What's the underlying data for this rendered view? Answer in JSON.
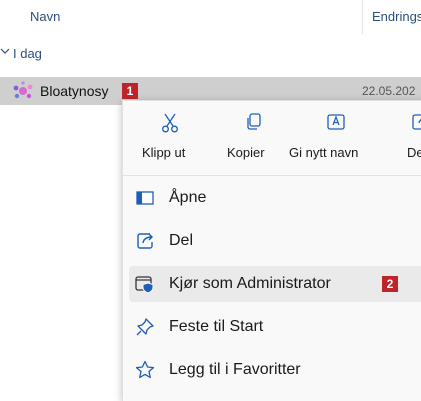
{
  "columns": {
    "name": "Navn",
    "date": "Endrings"
  },
  "group": {
    "label": "I dag"
  },
  "file": {
    "name": "Bloatynosy",
    "date": "22.05.202",
    "badge": "1"
  },
  "toolbar": [
    {
      "label": "Klipp ut",
      "icon": "scissors-icon"
    },
    {
      "label": "Kopier",
      "icon": "copy-icon"
    },
    {
      "label": "Gi nytt navn",
      "icon": "rename-icon"
    },
    {
      "label": "De",
      "icon": "share-icon"
    }
  ],
  "menu": {
    "items": [
      {
        "label": "Åpne",
        "icon": "open-icon"
      },
      {
        "label": "Del",
        "icon": "share-icon"
      },
      {
        "label": "Kjør som Administrator",
        "icon": "shield-window-icon",
        "badge": "2"
      },
      {
        "label": "Feste til Start",
        "icon": "pin-icon"
      },
      {
        "label": "Legg til i Favoritter",
        "icon": "star-icon"
      }
    ]
  },
  "colors": {
    "accent": "#2b4f7a",
    "badge": "#c0242b",
    "iconBlue": "#1e5fb4"
  }
}
